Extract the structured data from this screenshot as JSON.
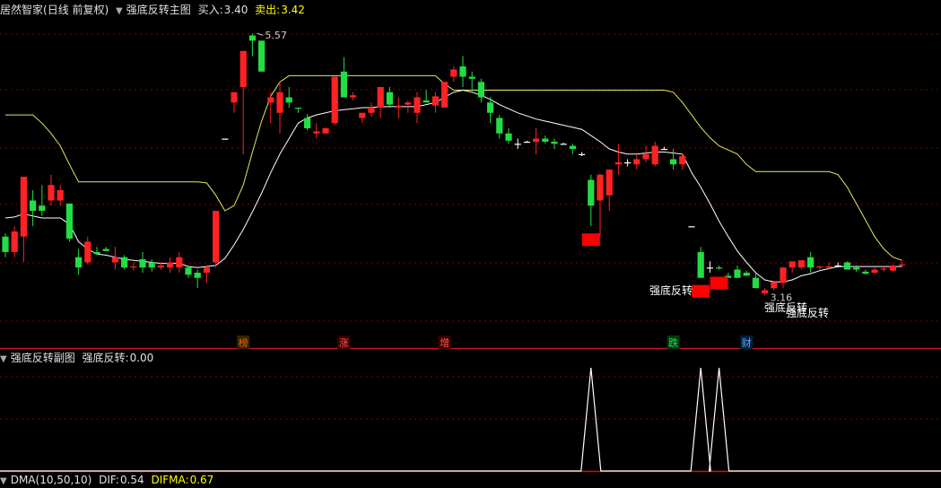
{
  "main_panel": {
    "stock_name": "居然智家",
    "period_label": "(日线 前复权)",
    "indicator_name": "强底反转主图",
    "buy_label": "买入:",
    "buy_value": "3.40",
    "sell_label": "卖出:",
    "sell_value": "3.42",
    "high_price_label": "5.57",
    "low_price_label": "3.16"
  },
  "sub_panel": {
    "indicator_name": "强底反转副图",
    "value_label": "强底反转:",
    "value": "0.00"
  },
  "bottom_panel": {
    "indicator_text": "DMA(10,50,10)",
    "dif_label": "DIF:",
    "dif_value": "0.54",
    "difma_label": "DIFMA:",
    "difma_value": "0.67"
  },
  "colors": {
    "background": "#000000",
    "up_candle": "#ff2222",
    "down_candle": "#22dd44",
    "doji": "#ffffff",
    "buy_line": "#ffffff",
    "sell_line": "#e8e85a",
    "signal_box": "#ff0000",
    "grid": "#8a0000",
    "separator": "#cc1111"
  },
  "chart_data": {
    "type": "candlestick",
    "series": [
      {
        "name": "candles",
        "ohlc": [
          [
            3.6,
            3.63,
            3.4,
            3.45
          ],
          [
            3.45,
            3.7,
            3.4,
            3.65
          ],
          [
            3.6,
            4.18,
            3.35,
            4.18
          ],
          [
            3.95,
            4.05,
            3.7,
            3.85
          ],
          [
            3.9,
            4.1,
            3.8,
            3.85
          ],
          [
            3.95,
            4.2,
            3.9,
            4.1
          ],
          [
            3.95,
            4.1,
            3.9,
            4.05
          ],
          [
            3.92,
            3.92,
            3.55,
            3.58
          ],
          [
            3.4,
            3.48,
            3.23,
            3.3
          ],
          [
            3.35,
            3.6,
            3.33,
            3.55
          ],
          [
            3.45,
            3.5,
            3.42,
            3.43
          ],
          [
            3.48,
            3.5,
            3.46,
            3.46
          ],
          [
            3.35,
            3.5,
            3.28,
            3.4
          ],
          [
            3.4,
            3.42,
            3.28,
            3.3
          ],
          [
            3.3,
            3.35,
            3.27,
            3.31
          ],
          [
            3.38,
            3.45,
            3.25,
            3.3
          ],
          [
            3.35,
            3.38,
            3.26,
            3.3
          ],
          [
            3.3,
            3.35,
            3.28,
            3.32
          ],
          [
            3.3,
            3.4,
            3.25,
            3.35
          ],
          [
            3.3,
            3.45,
            3.25,
            3.4
          ],
          [
            3.3,
            3.32,
            3.2,
            3.23
          ],
          [
            3.25,
            3.28,
            3.1,
            3.2
          ],
          [
            3.25,
            3.32,
            3.15,
            3.3
          ],
          [
            3.35,
            3.85,
            3.3,
            3.85
          ],
          [
            4.55,
            4.55,
            4.55,
            4.55
          ],
          [
            4.9,
            5.0,
            4.8,
            5.0
          ],
          [
            5.05,
            5.4,
            4.4,
            5.4
          ],
          [
            5.55,
            5.57,
            5.35,
            5.5
          ],
          [
            5.5,
            5.5,
            5.2,
            5.2
          ],
          [
            4.9,
            5.0,
            4.7,
            4.95
          ],
          [
            4.8,
            5.1,
            4.6,
            5.0
          ],
          [
            4.95,
            5.05,
            4.85,
            4.9
          ],
          [
            4.85,
            4.85,
            4.8,
            4.84
          ],
          [
            4.75,
            4.79,
            4.63,
            4.65
          ],
          [
            4.6,
            4.7,
            4.55,
            4.62
          ],
          [
            4.6,
            4.66,
            4.6,
            4.65
          ],
          [
            4.7,
            5.15,
            4.68,
            5.15
          ],
          [
            5.2,
            5.34,
            5.0,
            4.95
          ],
          [
            4.95,
            5.0,
            4.92,
            4.97
          ],
          [
            4.75,
            4.8,
            4.7,
            4.8
          ],
          [
            4.8,
            4.9,
            4.76,
            4.85
          ],
          [
            4.85,
            5.05,
            4.75,
            5.05
          ],
          [
            5.0,
            5.05,
            4.85,
            4.88
          ],
          [
            4.85,
            4.95,
            4.75,
            4.87
          ],
          [
            4.88,
            4.92,
            4.8,
            4.9
          ],
          [
            4.8,
            5.0,
            4.7,
            4.95
          ],
          [
            4.92,
            5.02,
            4.9,
            4.9
          ],
          [
            4.87,
            5.0,
            4.8,
            4.96
          ],
          [
            4.85,
            5.1,
            4.85,
            5.1
          ],
          [
            5.15,
            5.25,
            5.1,
            5.22
          ],
          [
            5.25,
            5.35,
            5.05,
            5.15
          ],
          [
            5.15,
            5.2,
            5.0,
            5.13
          ],
          [
            5.1,
            5.13,
            4.9,
            4.95
          ],
          [
            4.9,
            4.95,
            4.7,
            4.8
          ],
          [
            4.75,
            4.78,
            4.55,
            4.6
          ],
          [
            4.6,
            4.65,
            4.5,
            4.53
          ],
          [
            4.5,
            4.55,
            4.45,
            4.5
          ],
          [
            4.52,
            4.53,
            4.51,
            4.52
          ],
          [
            4.52,
            4.65,
            4.4,
            4.55
          ],
          [
            4.55,
            4.58,
            4.5,
            4.52
          ],
          [
            4.52,
            4.55,
            4.45,
            4.5
          ],
          [
            4.5,
            4.51,
            4.49,
            4.5
          ],
          [
            4.48,
            4.5,
            4.4,
            4.45
          ],
          [
            4.4,
            4.42,
            4.38,
            4.4
          ],
          [
            4.15,
            4.2,
            3.7,
            3.9
          ],
          [
            3.95,
            4.21,
            3.6,
            4.2
          ],
          [
            4.0,
            4.25,
            3.85,
            4.25
          ],
          [
            4.3,
            4.5,
            4.2,
            4.32
          ],
          [
            4.32,
            4.35,
            4.28,
            4.32
          ],
          [
            4.3,
            4.4,
            4.25,
            4.35
          ],
          [
            4.35,
            4.48,
            4.32,
            4.4
          ],
          [
            4.3,
            4.52,
            4.28,
            4.48
          ],
          [
            4.45,
            4.47,
            4.44,
            4.45
          ],
          [
            4.35,
            4.45,
            4.25,
            4.3
          ],
          [
            4.3,
            4.4,
            4.25,
            4.38
          ],
          [
            3.7,
            3.7,
            3.7,
            3.7
          ],
          [
            3.45,
            3.5,
            3.2,
            3.2
          ],
          [
            3.3,
            3.36,
            3.25,
            3.3
          ],
          [
            3.3,
            3.32,
            3.28,
            3.29
          ],
          [
            3.22,
            3.25,
            3.2,
            3.2
          ],
          [
            3.28,
            3.32,
            3.2,
            3.2
          ],
          [
            3.25,
            3.27,
            3.23,
            3.22
          ],
          [
            3.2,
            3.25,
            3.1,
            3.1
          ],
          [
            3.05,
            3.1,
            3.03,
            3.08
          ],
          [
            3.1,
            3.16,
            3.08,
            3.16
          ],
          [
            3.15,
            3.3,
            3.1,
            3.3
          ],
          [
            3.3,
            3.35,
            3.25,
            3.36
          ],
          [
            3.3,
            3.36,
            3.28,
            3.37
          ],
          [
            3.4,
            3.45,
            3.25,
            3.3
          ],
          [
            3.3,
            3.32,
            3.28,
            3.31
          ],
          [
            3.3,
            3.35,
            3.28,
            3.31
          ],
          [
            3.32,
            3.35,
            3.3,
            3.32
          ],
          [
            3.35,
            3.36,
            3.28,
            3.28
          ],
          [
            3.3,
            3.32,
            3.26,
            3.28
          ],
          [
            3.26,
            3.28,
            3.23,
            3.24
          ],
          [
            3.25,
            3.3,
            3.24,
            3.28
          ],
          [
            3.28,
            3.3,
            3.26,
            3.29
          ],
          [
            3.27,
            3.33,
            3.26,
            3.32
          ],
          [
            3.32,
            3.36,
            3.3,
            3.33
          ]
        ]
      },
      {
        "name": "buy_line",
        "values": [
          3.78,
          3.79,
          3.82,
          3.8,
          3.78,
          3.78,
          3.78,
          3.72,
          3.55,
          3.48,
          3.43,
          3.42,
          3.4,
          3.38,
          3.37,
          3.36,
          3.35,
          3.34,
          3.34,
          3.34,
          3.31,
          3.3,
          3.31,
          3.32,
          3.39,
          3.52,
          3.67,
          3.84,
          4.02,
          4.22,
          4.4,
          4.55,
          4.7,
          4.75,
          4.78,
          4.8,
          4.82,
          4.83,
          4.84,
          4.85,
          4.85,
          4.86,
          4.86,
          4.86,
          4.86,
          4.86,
          4.88,
          4.9,
          4.95,
          5.0,
          5.02,
          5.0,
          4.97,
          4.93,
          4.88,
          4.84,
          4.8,
          4.77,
          4.74,
          4.72,
          4.7,
          4.68,
          4.66,
          4.64,
          4.58,
          4.52,
          4.45,
          4.42,
          4.4,
          4.4,
          4.41,
          4.42,
          4.42,
          4.41,
          4.4,
          4.22,
          4.08,
          3.92,
          3.75,
          3.6,
          3.46,
          3.35,
          3.25,
          3.18,
          3.16,
          3.16,
          3.18,
          3.22,
          3.24,
          3.27,
          3.29,
          3.31,
          3.31,
          3.31,
          3.31,
          3.31,
          3.31,
          3.31,
          3.31
        ]
      },
      {
        "name": "sell_line",
        "values": [
          4.78,
          4.78,
          4.78,
          4.78,
          4.7,
          4.6,
          4.48,
          4.3,
          4.13,
          4.13,
          4.13,
          4.13,
          4.13,
          4.13,
          4.13,
          4.13,
          4.13,
          4.13,
          4.13,
          4.13,
          4.13,
          4.13,
          4.12,
          4.0,
          3.85,
          3.9,
          4.1,
          4.42,
          4.72,
          4.96,
          5.1,
          5.16,
          5.16,
          5.16,
          5.16,
          5.16,
          5.16,
          5.16,
          5.16,
          5.16,
          5.16,
          5.16,
          5.16,
          5.16,
          5.16,
          5.16,
          5.16,
          5.16,
          5.08,
          5.02,
          5.02,
          5.02,
          5.02,
          5.02,
          5.02,
          5.02,
          5.02,
          5.02,
          5.02,
          5.02,
          5.02,
          5.02,
          5.02,
          5.02,
          5.02,
          5.02,
          5.02,
          5.02,
          5.02,
          5.02,
          5.02,
          5.02,
          5.02,
          5.0,
          4.9,
          4.78,
          4.66,
          4.56,
          4.48,
          4.44,
          4.4,
          4.3,
          4.23,
          4.23,
          4.23,
          4.23,
          4.23,
          4.23,
          4.23,
          4.23,
          4.23,
          4.2,
          4.08,
          3.92,
          3.76,
          3.6,
          3.48,
          3.4,
          3.37
        ]
      }
    ],
    "ylim": [
      2.78,
      5.72
    ],
    "signal_bars": [
      64,
      76,
      78
    ],
    "signal_label": "强底反转",
    "event_markers": [
      {
        "bar": 26,
        "label": "榜",
        "color": "#e06b00",
        "bg": "#3a2000"
      },
      {
        "bar": 37,
        "label": "涨",
        "color": "#ff5555",
        "bg": "#3a0000"
      },
      {
        "bar": 48,
        "label": "增",
        "color": "#ff5555",
        "bg": "#3a0000"
      },
      {
        "bar": 73,
        "label": "跌",
        "color": "#33dd55",
        "bg": "#003a10"
      },
      {
        "bar": 81,
        "label": "财",
        "color": "#6aa8ff",
        "bg": "#00203a"
      }
    ],
    "sub_series": {
      "name": "强底反转",
      "spike_bars": [
        64,
        76,
        78
      ]
    }
  }
}
